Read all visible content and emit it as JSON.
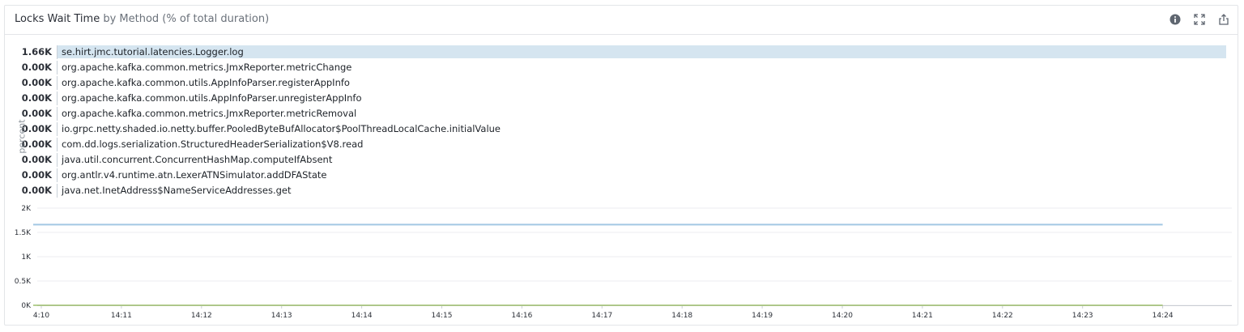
{
  "panel": {
    "title_main": "Locks Wait Time",
    "title_rest": "by Method (% of total duration)",
    "icons": [
      "info-icon",
      "expand-icon",
      "export-icon"
    ]
  },
  "toplist": {
    "rows": [
      {
        "value": "1.66K",
        "label": "se.hirt.jmc.tutorial.latencies.Logger.log",
        "fraction": 1.0
      },
      {
        "value": "0.00K",
        "label": "org.apache.kafka.common.metrics.JmxReporter.metricChange",
        "fraction": 0
      },
      {
        "value": "0.00K",
        "label": "org.apache.kafka.common.utils.AppInfoParser.registerAppInfo",
        "fraction": 0
      },
      {
        "value": "0.00K",
        "label": "org.apache.kafka.common.utils.AppInfoParser.unregisterAppInfo",
        "fraction": 0
      },
      {
        "value": "0.00K",
        "label": "org.apache.kafka.common.metrics.JmxReporter.metricRemoval",
        "fraction": 0
      },
      {
        "value": "0.00K",
        "label": "io.grpc.netty.shaded.io.netty.buffer.PooledByteBufAllocator$PoolThreadLocalCache.initialValue",
        "fraction": 0
      },
      {
        "value": "0.00K",
        "label": "com.dd.logs.serialization.StructuredHeaderSerialization$V8.read",
        "fraction": 0
      },
      {
        "value": "0.00K",
        "label": "java.util.concurrent.ConcurrentHashMap.computeIfAbsent",
        "fraction": 0
      },
      {
        "value": "0.00K",
        "label": "org.antlr.v4.runtime.atn.LexerATNSimulator.addDFAState",
        "fraction": 0
      },
      {
        "value": "0.00K",
        "label": "java.net.InetAddress$NameServiceAddresses.get",
        "fraction": 0
      }
    ]
  },
  "chart_data": {
    "type": "line",
    "ylabel": "percent",
    "xlabel": "",
    "ylim": [
      0,
      2000
    ],
    "ytick_labels": [
      "0K",
      "0.5K",
      "1K",
      "1.5K",
      "2K"
    ],
    "yticks": [
      0,
      500,
      1000,
      1500,
      2000
    ],
    "x": [
      "4:10",
      "14:11",
      "14:12",
      "14:13",
      "14:14",
      "14:15",
      "14:16",
      "14:17",
      "14:18",
      "14:19",
      "14:20",
      "14:21",
      "14:22",
      "14:23",
      "14:24"
    ],
    "grid": true,
    "series": [
      {
        "color": "#a3c8e3",
        "values": [
          1660,
          1660,
          1660,
          1660,
          1660,
          1660,
          1660,
          1660,
          1660,
          1660,
          1660,
          1660,
          1660,
          1660,
          1660
        ]
      },
      {
        "color": "#e8b05a",
        "values": [
          0,
          0,
          0,
          0,
          0,
          0,
          0,
          0,
          0,
          0,
          0,
          0,
          0,
          0,
          0
        ]
      },
      {
        "color": "#8fbf6a",
        "values": [
          0,
          0,
          0,
          0,
          0,
          0,
          0,
          0,
          0,
          0,
          0,
          0,
          0,
          0,
          0
        ]
      }
    ]
  }
}
